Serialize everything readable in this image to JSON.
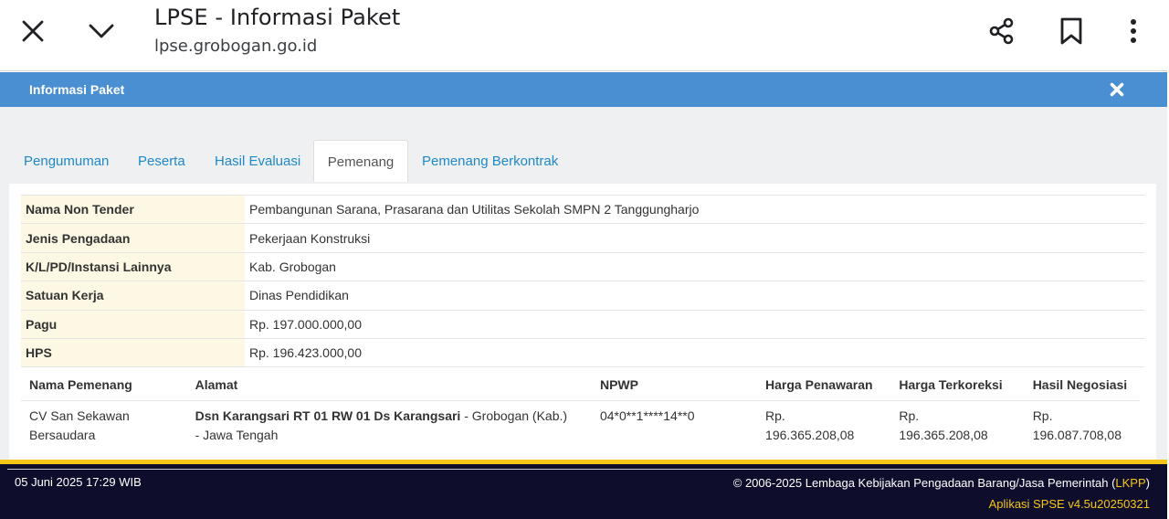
{
  "browser": {
    "title": "LPSE - Informasi Paket",
    "url": "lpse.grobogan.go.id",
    "icons": [
      "close-icon",
      "chevron-down-icon",
      "share-icon",
      "bookmark-icon",
      "more-vert-icon"
    ]
  },
  "modal": {
    "title": "Informasi Paket",
    "close_icon": "close-icon",
    "header_color": "#4a8fd1"
  },
  "tabs": [
    {
      "label": "Pengumuman",
      "active": false
    },
    {
      "label": "Peserta",
      "active": false
    },
    {
      "label": "Hasil Evaluasi",
      "active": false
    },
    {
      "label": "Pemenang",
      "active": true
    },
    {
      "label": "Pemenang Berkontrak",
      "active": false
    }
  ],
  "info": [
    {
      "label": "Nama Non Tender",
      "value": "Pembangunan Sarana, Prasarana dan Utilitas Sekolah SMPN 2 Tanggungharjo"
    },
    {
      "label": "Jenis Pengadaan",
      "value": "Pekerjaan Konstruksi"
    },
    {
      "label": "K/L/PD/Instansi Lainnya",
      "value": "Kab. Grobogan"
    },
    {
      "label": "Satuan Kerja",
      "value": "Dinas Pendidikan"
    },
    {
      "label": "Pagu",
      "value": "Rp. 197.000.000,00"
    },
    {
      "label": "HPS",
      "value": "Rp. 196.423.000,00"
    }
  ],
  "winner_table": {
    "headers": [
      "Nama Pemenang",
      "Alamat",
      "NPWP",
      "Harga Penawaran",
      "Harga Terkoreksi",
      "Hasil Negosiasi"
    ],
    "rows": [
      {
        "nama": "CV San Sekawan Bersaudara",
        "alamat_bold": "Dsn Karangsari RT 01 RW 01 Ds Karangsari",
        "alamat_rest": " - Grobogan (Kab.) - Jawa Tengah",
        "npwp": "04*0**1****14**0",
        "harga_penawaran": "Rp. 196.365.208,08",
        "harga_terkoreksi": "Rp. 196.365.208,08",
        "hasil_negosiasi": "Rp. 196.087.708,08"
      }
    ]
  },
  "footer": {
    "date": "05 Juni 2025 17:29 WIB",
    "copyright_prefix": "© 2006-2025 Lembaga Kebijakan Pengadaan Barang/Jasa Pemerintah (",
    "copyright_link": "LKPP",
    "copyright_suffix": ")",
    "app_version": "Aplikasi SPSE v4.5u20250321",
    "accent_color": "#f5c518"
  }
}
